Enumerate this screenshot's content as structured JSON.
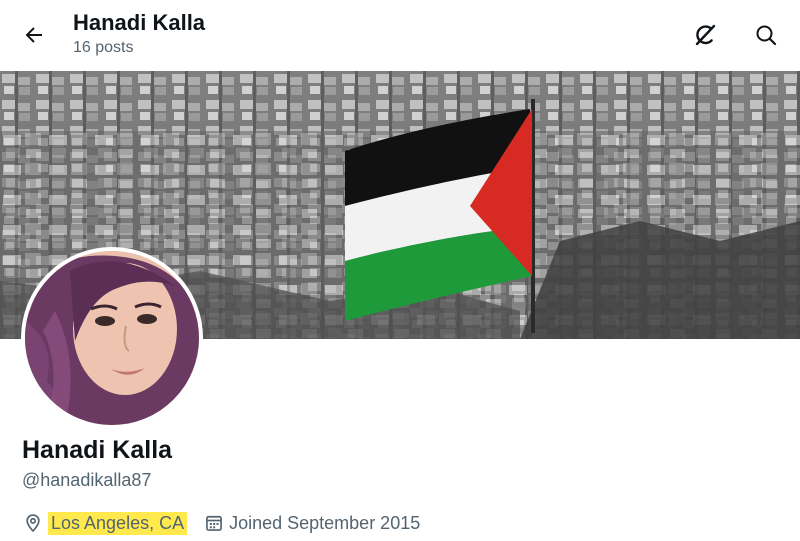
{
  "header": {
    "title": "Hanadi Kalla",
    "subtitle": "16 posts",
    "back_icon": "arrow-left-icon",
    "grok_icon": "grok-icon",
    "search_icon": "search-icon"
  },
  "profile": {
    "display_name": "Hanadi Kalla",
    "handle": "@hanadikalla87",
    "location": "Los Angeles, CA",
    "location_highlight_color": "#ffe94d",
    "joined": "Joined September 2015"
  },
  "colors": {
    "text_primary": "#0f1419",
    "text_secondary": "#536471",
    "flag_black": "#111111",
    "flag_white": "#f4f4f4",
    "flag_green": "#1f9a3a",
    "flag_red": "#d62a22"
  }
}
